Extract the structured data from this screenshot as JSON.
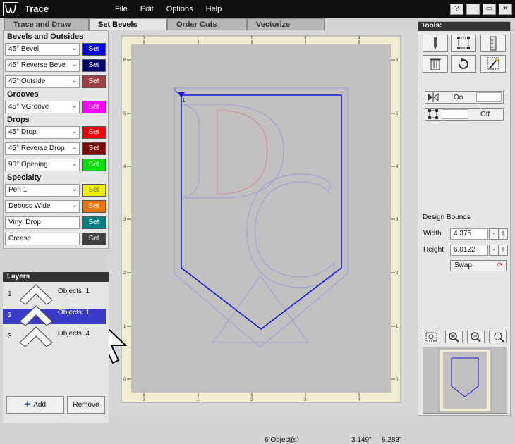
{
  "app": {
    "title": "Trace"
  },
  "menu": [
    "File",
    "Edit",
    "Options",
    "Help"
  ],
  "window_buttons": [
    "?",
    "−",
    "▭",
    "✕"
  ],
  "tabs": [
    "Trace and Draw",
    "Set Bevels",
    "Order Cuts",
    "Vectorize"
  ],
  "active_tab": "Set Bevels",
  "bevels": {
    "set_label": "Set",
    "sections": [
      {
        "heading": "Bevels and Outsides",
        "items": [
          {
            "value": "45° Bevel",
            "type": "dropdown",
            "color": "#0000e0"
          },
          {
            "value": "45° Reverse Beve",
            "type": "dropdown",
            "color": "#000070"
          },
          {
            "value": "45° Outside",
            "type": "dropdown",
            "color": "#a04040"
          }
        ]
      },
      {
        "heading": "Grooves",
        "items": [
          {
            "value": "45° VGroove",
            "type": "dropdown",
            "color": "#ff00ff"
          }
        ]
      },
      {
        "heading": "Drops",
        "items": [
          {
            "value": "45° Drop",
            "type": "dropdown",
            "color": "#ee0000"
          },
          {
            "value": "45° Reverse Drop",
            "type": "dropdown",
            "color": "#800000"
          },
          {
            "value": "90° Opening",
            "type": "dropdown",
            "color": "#00e000"
          }
        ]
      },
      {
        "heading": "Specialty",
        "items": [
          {
            "value": "Pen 1",
            "type": "dropdown",
            "color": "#f0f000"
          },
          {
            "value": "Deboss Wide",
            "type": "dropdown",
            "color": "#f07000"
          },
          {
            "value": "Vinyl Drop",
            "type": "text",
            "color": "#008080"
          },
          {
            "value": "Crease",
            "type": "text",
            "color": "#404040"
          }
        ]
      }
    ]
  },
  "layers": {
    "header": "Layers",
    "rows": [
      {
        "num": "1",
        "objects": "Objects: 1",
        "selected": false
      },
      {
        "num": "2",
        "objects": "Objects: 1",
        "selected": true
      },
      {
        "num": "3",
        "objects": "Objects: 4",
        "selected": false
      }
    ],
    "add_label": "Add",
    "remove_label": "Remove"
  },
  "canvas": {
    "ruler_h": [
      "0",
      "1",
      "2",
      "3",
      "4"
    ],
    "ruler_v": [
      "6",
      "5",
      "4",
      "3",
      "2",
      "1",
      "0"
    ],
    "path_start_label": "1",
    "status_objects": "6 Object(s)",
    "status_x": "3.149\"",
    "status_y": "6.283\""
  },
  "tools": {
    "header": "Tools:",
    "icons": [
      "knife-icon",
      "node-select-icon",
      "ruler-icon",
      "trash-icon",
      "rotate-icon",
      "magic-select-icon"
    ],
    "toggle_on_label": "On",
    "toggle_off_label": "Off"
  },
  "design_bounds": {
    "title": "Design Bounds",
    "width_label": "Width",
    "width_value": "4.375",
    "height_label": "Height",
    "height_value": "6.0122",
    "swap_label": "Swap",
    "minus": "-",
    "plus": "+"
  },
  "zoom_icons": [
    "zoom-fit-icon",
    "zoom-in-icon",
    "zoom-out-icon",
    "zoom-reset-icon"
  ]
}
